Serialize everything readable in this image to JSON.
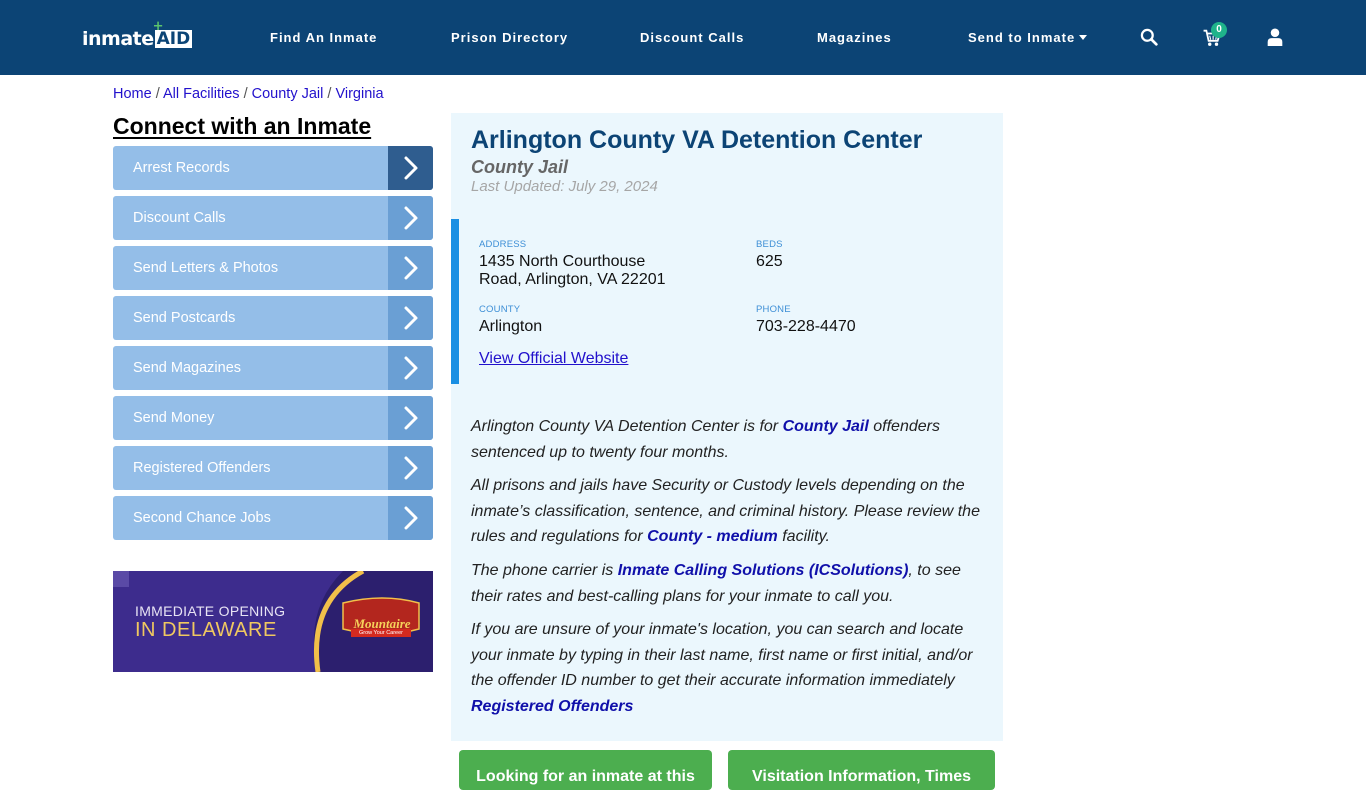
{
  "header": {
    "logo": {
      "part1": "inmate",
      "part2": "AID",
      "plus": "+"
    },
    "nav": [
      {
        "label": "Find An Inmate"
      },
      {
        "label": "Prison Directory"
      },
      {
        "label": "Discount Calls"
      },
      {
        "label": "Magazines"
      },
      {
        "label": "Send to Inmate",
        "has_dropdown": true
      }
    ],
    "icons": {
      "search": "search-icon",
      "cart": "cart-icon",
      "user": "user-icon"
    },
    "cart_count": "0"
  },
  "breadcrumb": [
    {
      "label": "Home"
    },
    {
      "label": "All Facilities"
    },
    {
      "label": "County Jail"
    },
    {
      "label": "Virginia"
    }
  ],
  "breadcrumb_separator": "/",
  "sidebar": {
    "title": "Connect with an Inmate",
    "items": [
      {
        "label": "Arrest Records",
        "active": true
      },
      {
        "label": "Discount Calls"
      },
      {
        "label": "Send Letters & Photos"
      },
      {
        "label": "Send Postcards"
      },
      {
        "label": "Send Magazines"
      },
      {
        "label": "Send Money"
      },
      {
        "label": "Registered Offenders"
      },
      {
        "label": "Second Chance Jobs"
      }
    ],
    "ad": {
      "line1": "IMMEDIATE OPENING",
      "line2": "IN DELAWARE",
      "brand": "Mountaire",
      "tagline": "Grow Your Career"
    }
  },
  "facility": {
    "name": "Arlington County VA Detention Center",
    "type": "County Jail",
    "last_updated": "Last Updated: July 29, 2024",
    "info": {
      "address_label": "ADDRESS",
      "address_line1": "1435 North Courthouse",
      "address_line2": "Road, Arlington, VA 22201",
      "beds_label": "BEDS",
      "beds": "625",
      "county_label": "COUNTY",
      "county": "Arlington",
      "phone_label": "PHONE",
      "phone": "703-228-4470",
      "website_link": "View Official Website"
    },
    "description": {
      "p1_a": "Arlington County VA Detention Center is for ",
      "p1_link": "County Jail",
      "p1_b": " offenders sentenced up to twenty four months.",
      "p2_a": "All prisons and jails have Security or Custody levels depending on the inmate’s classification, sentence, and criminal history. Please review the rules and regulations for ",
      "p2_link": "County - medium",
      "p2_b": " facility.",
      "p3_a": "The phone carrier is ",
      "p3_link": "Inmate Calling Solutions (ICSolutions)",
      "p3_b": ", to see their rates and best-calling plans for your inmate to call you.",
      "p4_a": "If you are unsure of your inmate's location, you can search and locate your inmate by typing in their last name, first name or first initial, and/or the offender ID number to get their accurate information immediately ",
      "p4_link": "Registered Offenders"
    },
    "buttons": [
      {
        "label": "Looking for an inmate at this"
      },
      {
        "label": "Visitation Information, Times"
      }
    ]
  },
  "colors": {
    "header_bg": "#0c4475",
    "sidebar_item": "#94bee8",
    "sidebar_arrow": "#6a9fd4",
    "sidebar_arrow_active": "#2f5d8f",
    "card_bg": "#ebf7fd",
    "accent_bar": "#1a8fe3",
    "green_button": "#4cae4f",
    "cart_badge": "#1fb38a"
  }
}
